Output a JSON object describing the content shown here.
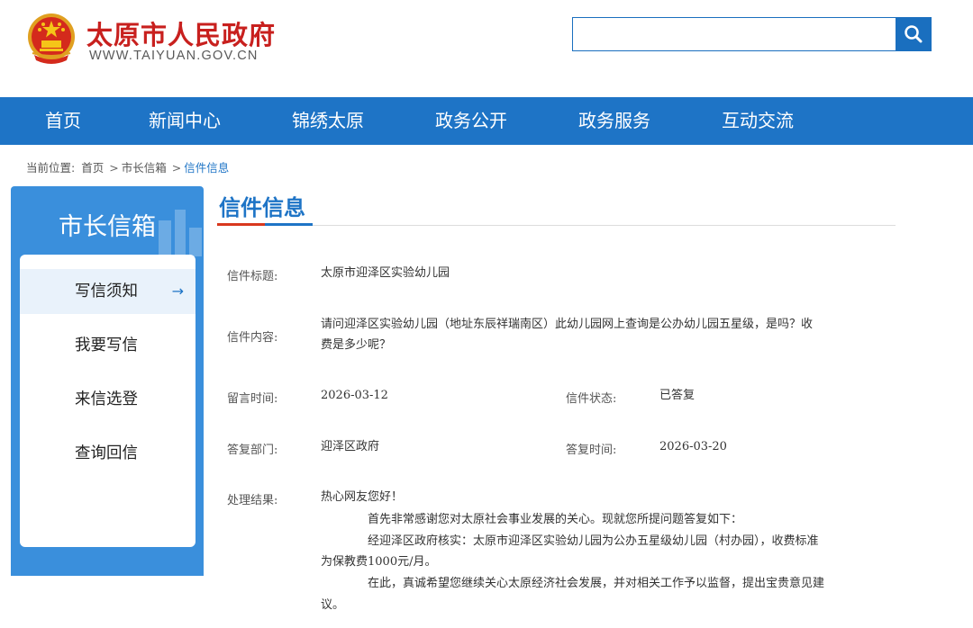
{
  "header": {
    "site_title": "太原市人民政府",
    "site_domain": "WWW.TAIYUAN.GOV.CN",
    "search_placeholder": ""
  },
  "nav": {
    "items": [
      "首页",
      "新闻中心",
      "锦绣太原",
      "政务公开",
      "政务服务",
      "互动交流"
    ]
  },
  "breadcrumb": {
    "label": "当前位置:",
    "items": [
      "首页",
      "市长信箱",
      "信件信息"
    ],
    "separator": ">"
  },
  "sidebar": {
    "title": "市长信箱",
    "items": [
      {
        "label": "写信须知",
        "active": true
      },
      {
        "label": "我要写信"
      },
      {
        "label": "来信选登"
      },
      {
        "label": "查询回信"
      }
    ],
    "arrow": "→"
  },
  "main": {
    "title": "信件信息",
    "fields": {
      "subject_label": "信件标题:",
      "subject": "太原市迎泽区实验幼儿园",
      "content_label": "信件内容:",
      "content_line1": "请问迎泽区实验幼儿园（地址东辰祥瑞南区）此幼儿园网上查询是公办幼儿园五星级，是吗？收",
      "content_line2": "费是多少呢？",
      "time_label": "留言时间:",
      "time": "2026-03-12",
      "status_label": "信件状态:",
      "status": "已答复",
      "dept_label": "答复部门:",
      "dept": "迎泽区政府",
      "reply_time_label": "答复时间:",
      "reply_time": "2026-03-20",
      "result_label": "处理结果:",
      "result_line1": "热心网友您好！",
      "result_line2": "首先非常感谢您对太原社会事业发展的关心。现就您所提问题答复如下：",
      "result_line3": "经迎泽区政府核实：太原市迎泽区实验幼儿园为公办五星级幼儿园（村办园），收费标准",
      "result_line4": "为保教费1000元/月。",
      "result_line5": "在此，真诚希望您继续关心太原经济社会发展，并对相关工作予以监督，提出宝贵意见建",
      "result_line6": "议。"
    }
  },
  "colors": {
    "brand_blue": "#1e74c6",
    "title_red": "#c8201e"
  }
}
